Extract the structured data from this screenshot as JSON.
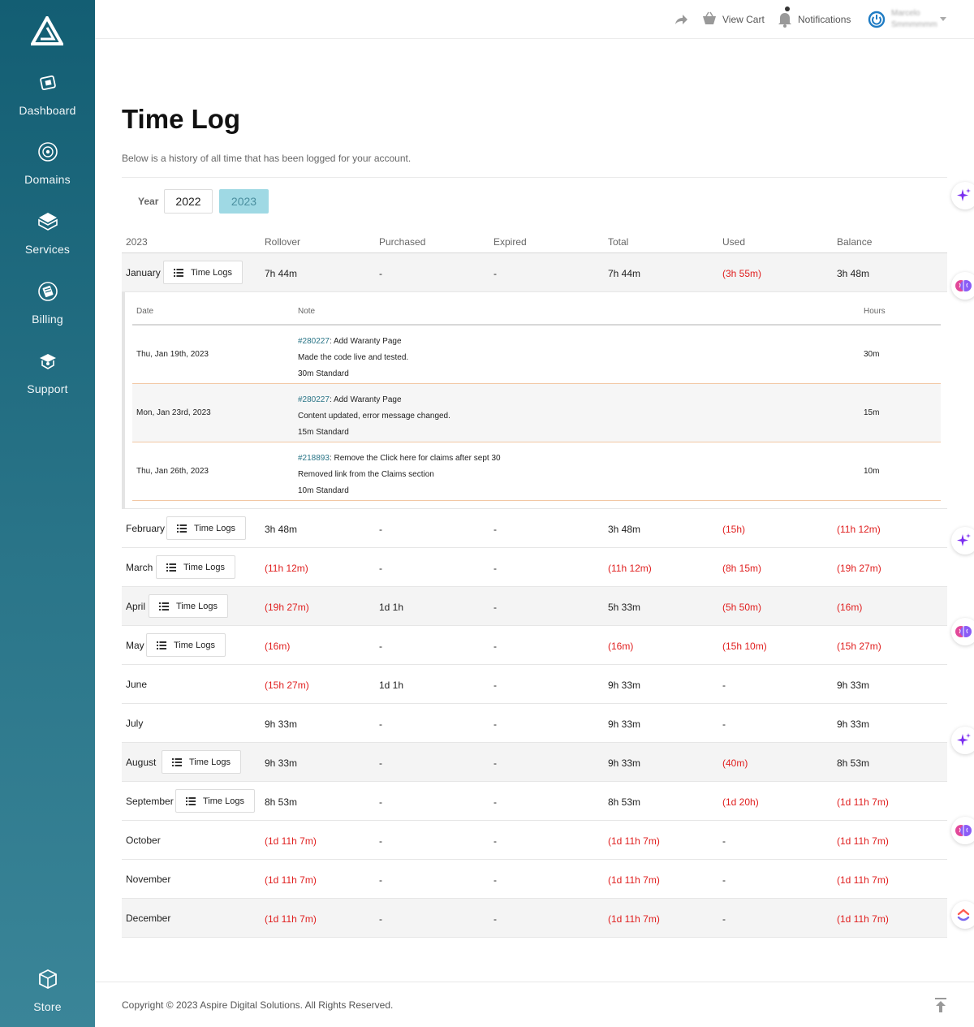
{
  "sidebar": {
    "items": [
      {
        "label": "Dashboard",
        "icon": "dashboard-icon"
      },
      {
        "label": "Domains",
        "icon": "globe-icon"
      },
      {
        "label": "Services",
        "icon": "box-icon"
      },
      {
        "label": "Billing",
        "icon": "billing-icon"
      },
      {
        "label": "Support",
        "icon": "support-icon"
      }
    ],
    "store": {
      "label": "Store",
      "icon": "store-icon"
    }
  },
  "header": {
    "cart_label": "View Cart",
    "notifications_label": "Notifications",
    "user_line1": "Marcelo",
    "user_line2": "Smmmmmm"
  },
  "page": {
    "title": "Time Log",
    "subtitle": "Below is a history of all time that has been logged for your account.",
    "year_label": "Year",
    "years": [
      "2022",
      "2023"
    ],
    "selected_year": "2023",
    "time_logs_label": "Time Logs"
  },
  "table": {
    "headers": [
      "2023",
      "Rollover",
      "Purchased",
      "Expired",
      "Total",
      "Used",
      "Balance"
    ],
    "rows": [
      {
        "month": "January",
        "has_logs": true,
        "rollover": "7h 44m",
        "purchased": "-",
        "expired": "-",
        "total": "7h 44m",
        "used": "(3h 55m)",
        "balance": "3h 48m"
      },
      {
        "month": "February",
        "has_logs": true,
        "rollover": "3h 48m",
        "purchased": "-",
        "expired": "-",
        "total": "3h 48m",
        "used": "(15h)",
        "balance": "(11h 12m)"
      },
      {
        "month": "March",
        "has_logs": true,
        "rollover": "(11h 12m)",
        "purchased": "-",
        "expired": "-",
        "total": "(11h 12m)",
        "used": "(8h 15m)",
        "balance": "(19h 27m)"
      },
      {
        "month": "April",
        "has_logs": true,
        "rollover": "(19h 27m)",
        "purchased": "1d 1h",
        "expired": "-",
        "total": "5h 33m",
        "used": "(5h 50m)",
        "balance": "(16m)"
      },
      {
        "month": "May",
        "has_logs": true,
        "rollover": "(16m)",
        "purchased": "-",
        "expired": "-",
        "total": "(16m)",
        "used": "(15h 10m)",
        "balance": "(15h 27m)"
      },
      {
        "month": "June",
        "has_logs": false,
        "rollover": "(15h 27m)",
        "purchased": "1d 1h",
        "expired": "-",
        "total": "9h 33m",
        "used": "-",
        "balance": "9h 33m"
      },
      {
        "month": "July",
        "has_logs": false,
        "rollover": "9h 33m",
        "purchased": "-",
        "expired": "-",
        "total": "9h 33m",
        "used": "-",
        "balance": "9h 33m"
      },
      {
        "month": "August",
        "has_logs": true,
        "rollover": "9h 33m",
        "purchased": "-",
        "expired": "-",
        "total": "9h 33m",
        "used": "(40m)",
        "balance": "8h 53m"
      },
      {
        "month": "September",
        "has_logs": true,
        "rollover": "8h 53m",
        "purchased": "-",
        "expired": "-",
        "total": "8h 53m",
        "used": "(1d 20h)",
        "balance": "(1d 11h 7m)"
      },
      {
        "month": "October",
        "has_logs": false,
        "rollover": "(1d 11h 7m)",
        "purchased": "-",
        "expired": "-",
        "total": "(1d 11h 7m)",
        "used": "-",
        "balance": "(1d 11h 7m)"
      },
      {
        "month": "November",
        "has_logs": false,
        "rollover": "(1d 11h 7m)",
        "purchased": "-",
        "expired": "-",
        "total": "(1d 11h 7m)",
        "used": "-",
        "balance": "(1d 11h 7m)"
      },
      {
        "month": "December",
        "has_logs": false,
        "rollover": "(1d 11h 7m)",
        "purchased": "-",
        "expired": "-",
        "total": "(1d 11h 7m)",
        "used": "-",
        "balance": "(1d 11h 7m)"
      }
    ]
  },
  "details": {
    "headers": [
      "Date",
      "Note",
      "Hours"
    ],
    "entries": [
      {
        "date": "Thu, Jan 19th, 2023",
        "ticket": "#280227",
        "title": ": Add Waranty Page",
        "note": "Made the code live and tested.",
        "type": "30m Standard",
        "hours": "30m"
      },
      {
        "date": "Mon, Jan 23rd, 2023",
        "ticket": "#280227",
        "title": ": Add Waranty Page",
        "note": "Content updated, error message changed.",
        "type": "15m Standard",
        "hours": "15m"
      },
      {
        "date": "Thu, Jan 26th, 2023",
        "ticket": "#218893",
        "title": ": Remove the Click here for claims after sept 30",
        "note": "Removed link from the Claims section",
        "type": "10m Standard",
        "hours": "10m"
      }
    ]
  },
  "footer": {
    "copyright": "Copyright © 2023 Aspire Digital Solutions. All Rights Reserved."
  },
  "colors": {
    "sidebar_top": "#135e73",
    "sidebar_bottom": "#3a8598",
    "accent_selected_year": "#9fd9e4",
    "negative": "#e01e1e",
    "link": "#2a7587"
  }
}
